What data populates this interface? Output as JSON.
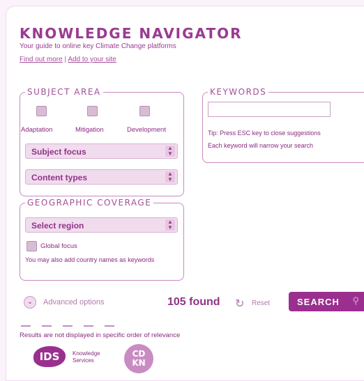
{
  "header": {
    "title": "KNOWLEDGE NAVIGATOR",
    "subtitle": "Your guide to online key Climate Change platforms",
    "find_out_more": "Find out more",
    "separator": "|",
    "add_to_site": "Add to your site"
  },
  "subject_area": {
    "legend": "SUBJECT AREA",
    "checkboxes": [
      {
        "label": "Adaptation",
        "checked": false
      },
      {
        "label": "Mitigation",
        "checked": false
      },
      {
        "label": "Development",
        "checked": false
      }
    ],
    "subject_focus": "Subject focus",
    "content_types": "Content types"
  },
  "keywords": {
    "legend": "KEYWORDS",
    "value": "",
    "tip": "Tip: Press ESC key to close suggestions",
    "hint": "Each keyword will narrow your search"
  },
  "geo": {
    "legend": "GEOGRAPHIC COVERAGE",
    "region": "Select region",
    "global_label": "Global focus",
    "global_checked": false,
    "hint": "You may also add country names as keywords"
  },
  "actions": {
    "advanced": "Advanced options",
    "found": "105 found",
    "reset": "Reset",
    "search": "SEARCH"
  },
  "footer": {
    "note": "Results are not displayed in specific order of relevance",
    "ids_logo": "IDS",
    "ids_text_1": "Knowledge",
    "ids_text_2": "Services",
    "cdkn_logo_1": "CD",
    "cdkn_logo_2": "KN"
  },
  "icons": {
    "chevron": "chevron-down-icon",
    "reset": "reset-icon",
    "search": "search-icon"
  },
  "colors": {
    "accent": "#9a2f8f",
    "light": "#f1dcee"
  }
}
